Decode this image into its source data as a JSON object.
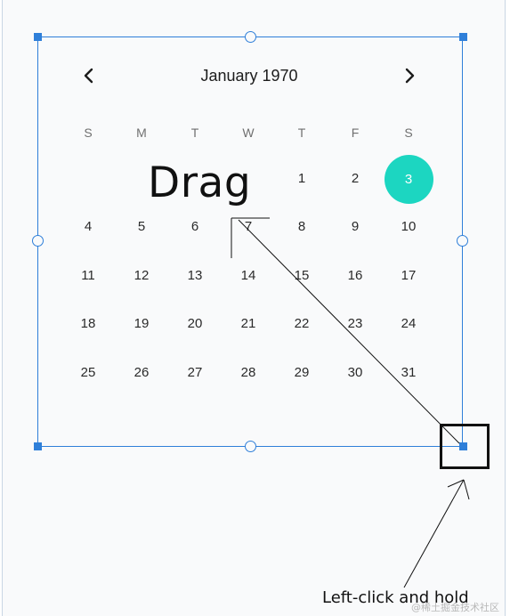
{
  "calendar": {
    "month_label": "January 1970",
    "weekdays": [
      "S",
      "M",
      "T",
      "W",
      "T",
      "F",
      "S"
    ],
    "weeks": [
      [
        "",
        "",
        "",
        "",
        "1",
        "2",
        "3"
      ],
      [
        "4",
        "5",
        "6",
        "7",
        "8",
        "9",
        "10"
      ],
      [
        "11",
        "12",
        "13",
        "14",
        "15",
        "16",
        "17"
      ],
      [
        "18",
        "19",
        "20",
        "21",
        "22",
        "23",
        "24"
      ],
      [
        "25",
        "26",
        "27",
        "28",
        "29",
        "30",
        "31"
      ]
    ],
    "selected_day": "3",
    "accent_color": "#1cd6c1"
  },
  "overlay": {
    "drag_label": "Drag",
    "instruction": "Left-click and hold",
    "watermark": "@稀土掘金技术社区",
    "selection_color": "#2f7fd9"
  },
  "icons": {
    "prev": "chevron-left-icon",
    "next": "chevron-right-icon"
  }
}
